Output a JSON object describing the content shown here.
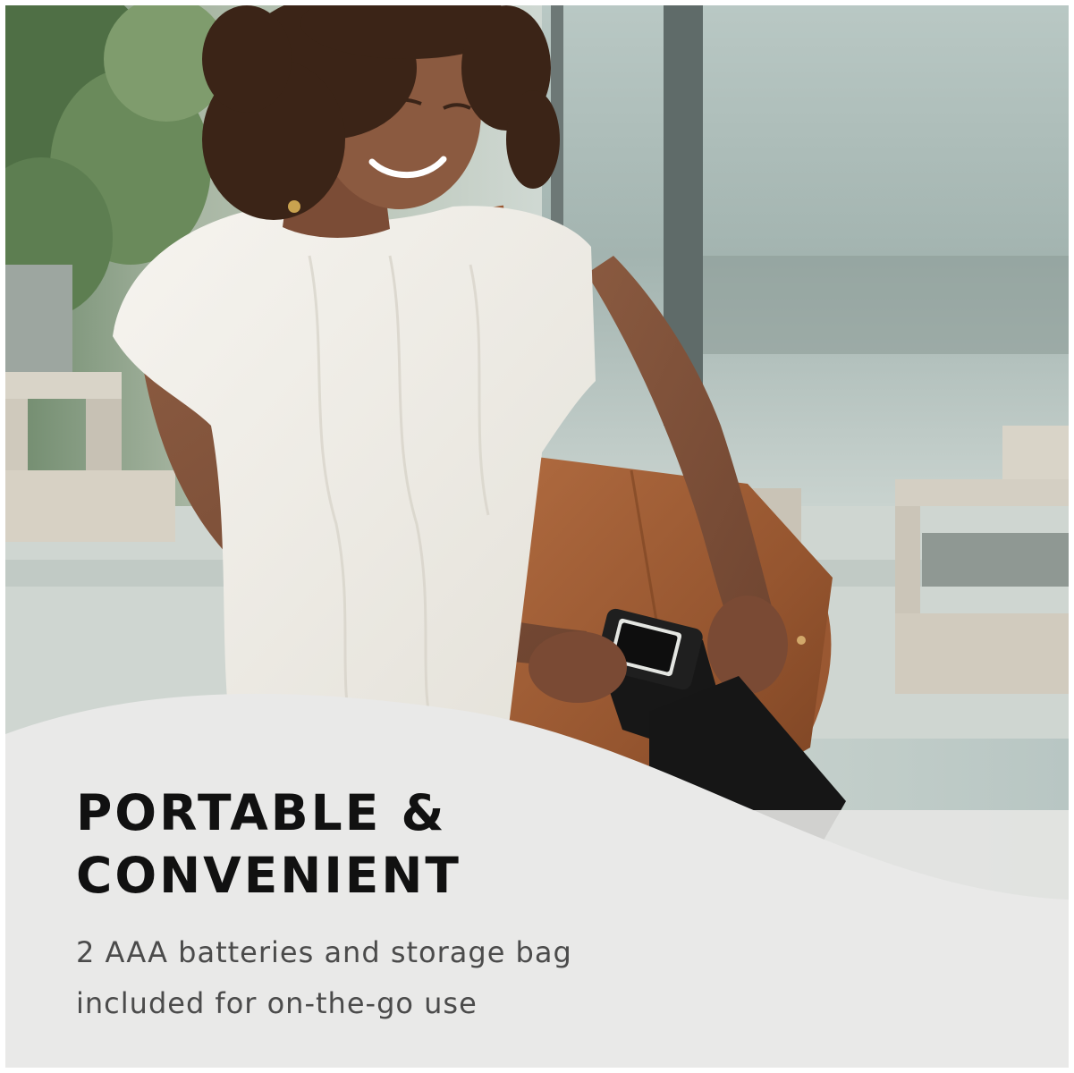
{
  "headline": {
    "line1": "PORTABLE &",
    "line2": "CONVENIENT"
  },
  "subtext": {
    "line1": "2 AAA batteries and storage bag",
    "line2": "included for on-the-go use"
  },
  "colors": {
    "panel_background": "#e9e9e8",
    "headline_text": "#111111",
    "body_text": "#4b4b4b",
    "bag_brown": "#9b5a34",
    "sweater_white": "#f1efe9",
    "device_black": "#1b1b1b"
  }
}
